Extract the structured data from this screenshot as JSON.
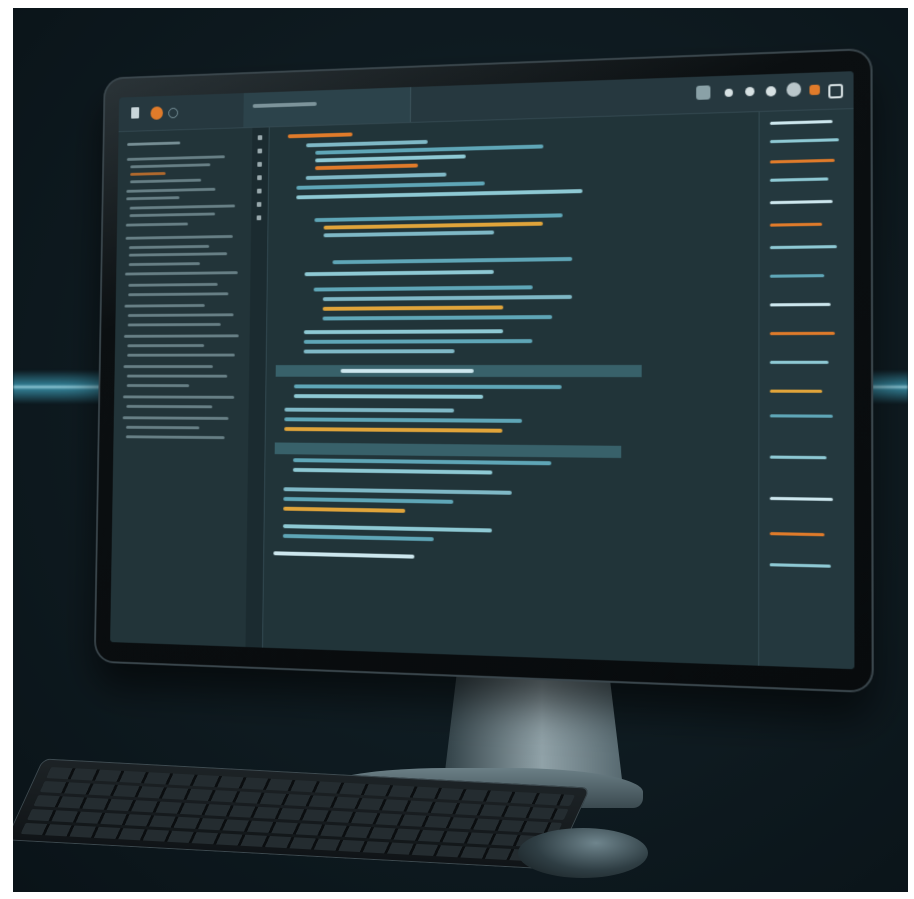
{
  "scene": {
    "subject": "desktop-computer-with-code-editor",
    "accent_color": "#4fd2f5",
    "brand_orange": "#e07b2a",
    "screen_bg": "#1f3238"
  },
  "icons": {
    "file": "file-icon",
    "badge": "orange-badge-icon",
    "toolbar": [
      "split-icon",
      "chat-icon",
      "circle-icon",
      "half-circle-icon",
      "user-icon",
      "orange-bag-icon",
      "settings-icon"
    ]
  }
}
